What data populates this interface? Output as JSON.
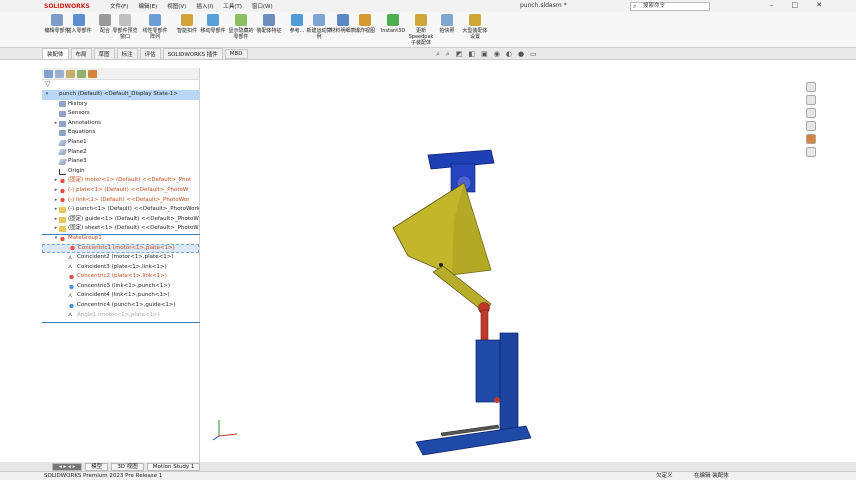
{
  "app": {
    "logo": "SOLIDWORKS",
    "title": "punch.sldasm *",
    "search_placeholder": "搜索命令",
    "status": "SOLIDWORKS Premium 2023 Pre Release 1"
  },
  "menu": [
    "文件(F)",
    "编辑(E)",
    "视图(V)",
    "插入(I)",
    "工具(T)",
    "窗口(W)"
  ],
  "ribbon": [
    {
      "label": "编辑零部件",
      "icon": "edit-component-icon",
      "color": "#7d9dc9"
    },
    {
      "label": "插入零部件",
      "icon": "insert-component-icon",
      "color": "#5b8fd0"
    },
    {
      "label": "配合",
      "icon": "mate-icon",
      "color": "#9a9a9a"
    },
    {
      "label": "零部件预览窗口",
      "icon": "preview-icon",
      "color": "#c0c0c0"
    },
    {
      "label": "线性零部件阵列",
      "icon": "pattern-icon",
      "color": "#6c9ed6"
    },
    {
      "label": "智能扣件",
      "icon": "fastener-icon",
      "color": "#d4a338"
    },
    {
      "label": "移动零部件",
      "icon": "move-icon",
      "color": "#5aa0d8"
    },
    {
      "label": "显示隐藏的零部件",
      "icon": "show-hidden-icon",
      "color": "#8cbf60"
    },
    {
      "label": "装配体特征",
      "icon": "assembly-feature-icon",
      "color": "#6c8fc0"
    },
    {
      "label": "参考...",
      "icon": "reference-icon",
      "color": "#4f9bd8"
    },
    {
      "label": "新建运动算例",
      "icon": "motion-icon",
      "color": "#7ca4d4"
    },
    {
      "label": "材料明细表",
      "icon": "bom-icon",
      "color": "#5c88c4"
    },
    {
      "label": "爆炸视图",
      "icon": "explode-icon",
      "color": "#d39b2e"
    },
    {
      "label": "Instant3D",
      "icon": "instant3d-icon",
      "color": "#4fae4f"
    },
    {
      "label": "更新 Speedpak 子装配体",
      "icon": "speedpak-icon",
      "color": "#d1a838"
    },
    {
      "label": "拍快照",
      "icon": "snapshot-icon",
      "color": "#7fa7d0"
    },
    {
      "label": "大型装配体设置",
      "icon": "large-assembly-icon",
      "color": "#d1a838"
    }
  ],
  "tabs": [
    "装配体",
    "布局",
    "草图",
    "标注",
    "评估",
    "SOLIDWORKS 插件",
    "MBD"
  ],
  "tree": [
    {
      "label": "punch (Default) <Default_Display State-1>",
      "icon": "assembly-icon",
      "style": "sel",
      "indent": 0,
      "tw": "▾"
    },
    {
      "label": "History",
      "icon": "folder",
      "style": "",
      "indent": 1,
      "tw": ""
    },
    {
      "label": "Sensors",
      "icon": "folder",
      "style": "",
      "indent": 1,
      "tw": ""
    },
    {
      "label": "Annotations",
      "icon": "folder",
      "style": "",
      "indent": 1,
      "tw": "▸"
    },
    {
      "label": "Equations",
      "icon": "folder",
      "style": "",
      "indent": 1,
      "tw": ""
    },
    {
      "label": "Plane1",
      "icon": "plane",
      "style": "",
      "indent": 1,
      "tw": ""
    },
    {
      "label": "Plane2",
      "icon": "plane",
      "style": "",
      "indent": 1,
      "tw": ""
    },
    {
      "label": "Plane3",
      "icon": "plane",
      "style": "",
      "indent": 1,
      "tw": ""
    },
    {
      "label": "Origin",
      "icon": "origin",
      "style": "",
      "indent": 1,
      "tw": ""
    },
    {
      "label": "(固定) motor<1> (Default) <<Default>_Phot",
      "icon": "red",
      "style": "orange",
      "indent": 1,
      "tw": "▸"
    },
    {
      "label": "(-) plate<1> (Default) <<Default>_PhotoW",
      "icon": "red",
      "style": "orange",
      "indent": 1,
      "tw": "▸"
    },
    {
      "label": "(-) link<1> (Default) <<Default>_PhotoWor",
      "icon": "red",
      "style": "orange",
      "indent": 1,
      "tw": "▸"
    },
    {
      "label": "(-) punch<1> (Default) <<Default>_PhotoWork",
      "icon": "yellow",
      "style": "",
      "indent": 1,
      "tw": "▸"
    },
    {
      "label": "(固定) guide<1> (Default) <<Default>_PhotoW",
      "icon": "yellow",
      "style": "",
      "indent": 1,
      "tw": "▸"
    },
    {
      "label": "(固定) sheet<1> (Default) <<Default>_PhotoW",
      "icon": "yellow",
      "style": "",
      "indent": 1,
      "tw": "▸"
    },
    {
      "label": "MateGroup1",
      "icon": "red",
      "style": "orange",
      "indent": 1,
      "tw": "▾"
    },
    {
      "label": "Concentric1 (motor<1>,plate<1>)",
      "icon": "red",
      "style": "orange hover",
      "indent": 2,
      "tw": ""
    },
    {
      "label": "Coincident2 (motor<1>,plate<1>)",
      "icon": "coin",
      "style": "",
      "indent": 2,
      "tw": ""
    },
    {
      "label": "Coincident3 (plate<1>,link<1>)",
      "icon": "coin",
      "style": "",
      "indent": 2,
      "tw": ""
    },
    {
      "label": "Concentric2 (plate<1>,link<1>)",
      "icon": "red",
      "style": "orange",
      "indent": 2,
      "tw": ""
    },
    {
      "label": "Concentric3 (link<1>,punch<1>)",
      "icon": "blue",
      "style": "",
      "indent": 2,
      "tw": ""
    },
    {
      "label": "Coincident4 (link<1>,punch<1>)",
      "icon": "coin",
      "style": "",
      "indent": 2,
      "tw": ""
    },
    {
      "label": "Concentric4 (punch<1>,guide<1>)",
      "icon": "blue",
      "style": "",
      "indent": 2,
      "tw": ""
    },
    {
      "label": "Angle1 (motor<1>,plate<1>)",
      "icon": "coin",
      "style": "faded",
      "indent": 2,
      "tw": ""
    }
  ],
  "bottom_tabs": [
    "模型",
    "3D 视图",
    "Motion Study 1"
  ],
  "status_right": [
    "欠定义",
    "在编辑 装配体"
  ]
}
